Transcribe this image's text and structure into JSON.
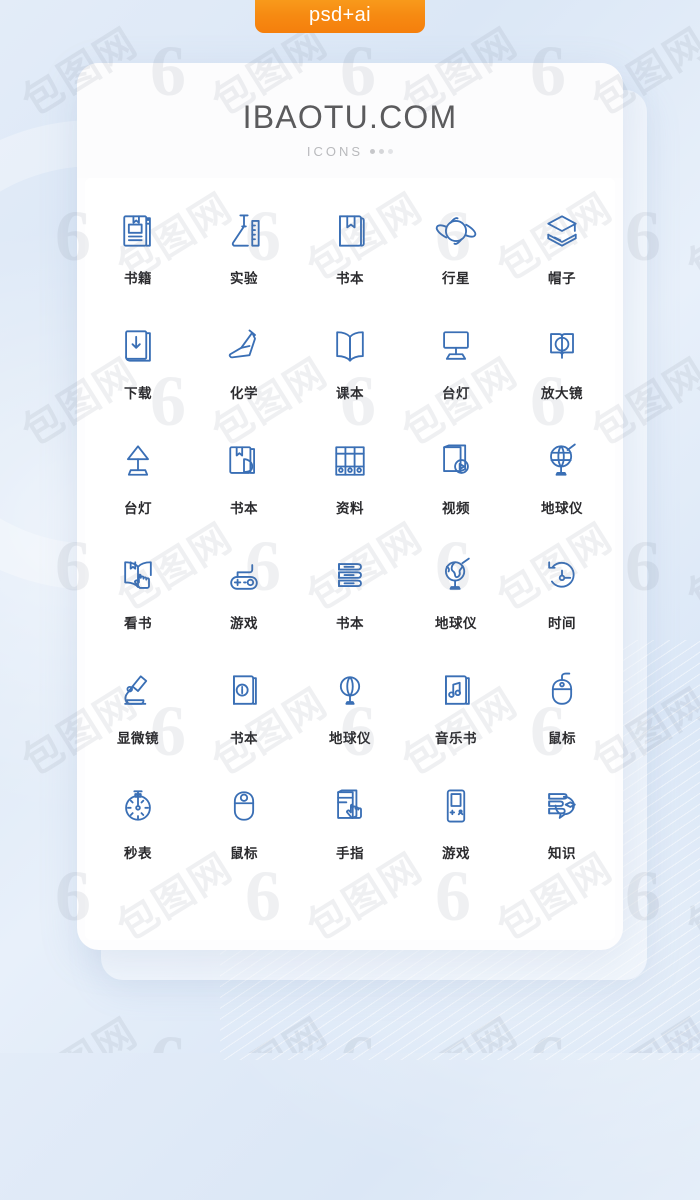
{
  "badge": {
    "label": "psd+ai",
    "color": "#f68a12"
  },
  "card": {
    "brand": "IBAOTU.COM",
    "subtitle": "ICONS",
    "icon_color": "#3a6fb5",
    "label_color": "#2b2b2e"
  },
  "watermark": {
    "cn": "包图网",
    "mark": "6"
  },
  "icons": [
    {
      "label": "书籍",
      "name": "book-stack-icon"
    },
    {
      "label": "实验",
      "name": "flask-experiment-icon"
    },
    {
      "label": "书本",
      "name": "bookmark-book-icon"
    },
    {
      "label": "行星",
      "name": "planet-icon"
    },
    {
      "label": "帽子",
      "name": "graduation-cap-icon"
    },
    {
      "label": "下载",
      "name": "download-book-icon"
    },
    {
      "label": "化学",
      "name": "chemistry-flask-icon"
    },
    {
      "label": "课本",
      "name": "open-textbook-icon"
    },
    {
      "label": "台灯",
      "name": "monitor-lamp-icon"
    },
    {
      "label": "放大镜",
      "name": "magnifier-book-icon"
    },
    {
      "label": "台灯",
      "name": "desk-lamp-icon"
    },
    {
      "label": "书本",
      "name": "book-leaf-icon"
    },
    {
      "label": "资料",
      "name": "file-binders-icon"
    },
    {
      "label": "视频",
      "name": "video-book-icon"
    },
    {
      "label": "地球仪",
      "name": "globe-stand-icon"
    },
    {
      "label": "看书",
      "name": "reading-hand-icon"
    },
    {
      "label": "游戏",
      "name": "gamepad-icon"
    },
    {
      "label": "书本",
      "name": "stacked-books-icon"
    },
    {
      "label": "地球仪",
      "name": "globe-world-icon"
    },
    {
      "label": "时间",
      "name": "clock-time-icon"
    },
    {
      "label": "显微镜",
      "name": "microscope-icon"
    },
    {
      "label": "书本",
      "name": "info-book-icon"
    },
    {
      "label": "地球仪",
      "name": "globe-simple-icon"
    },
    {
      "label": "音乐书",
      "name": "music-book-icon"
    },
    {
      "label": "鼠标",
      "name": "mouse-scroll-icon"
    },
    {
      "label": "秒表",
      "name": "stopwatch-icon"
    },
    {
      "label": "鼠标",
      "name": "computer-mouse-icon"
    },
    {
      "label": "手指",
      "name": "finger-touch-icon"
    },
    {
      "label": "游戏",
      "name": "handheld-console-icon"
    },
    {
      "label": "知识",
      "name": "knowledge-bubble-icon"
    }
  ]
}
